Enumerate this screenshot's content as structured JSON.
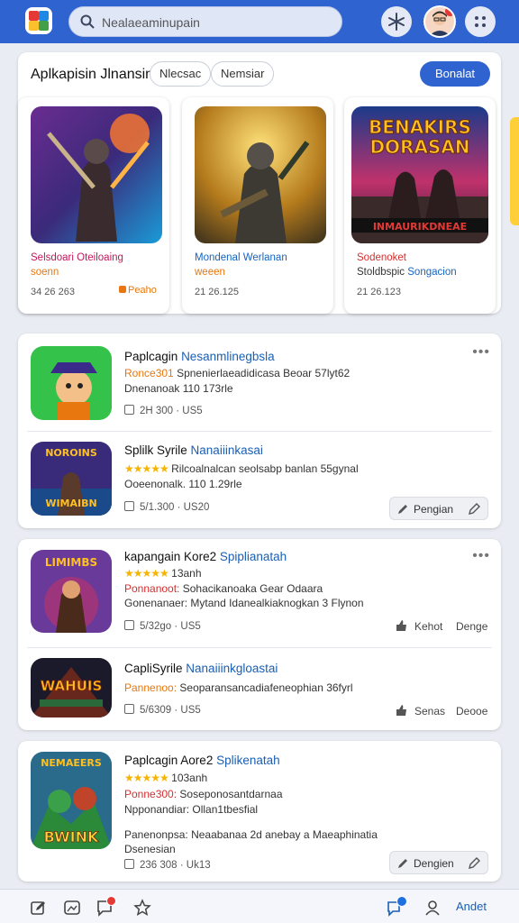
{
  "search": {
    "value": "Nealaeaminupain"
  },
  "featured": {
    "title": "Aplkapisin Jlnansin",
    "chips": [
      "Nlecsac",
      "Nemsiar"
    ],
    "primary_button": "Bonalat",
    "items": [
      {
        "name": "Selsdoari Oteiloaing",
        "sub": "soenn",
        "meta": "34 26 263",
        "tag": "Peaho"
      },
      {
        "name": "Mondenal Werlanan",
        "sub": "weeen",
        "meta": "21 26.125",
        "tag": ""
      },
      {
        "name": "Sodenoket",
        "sub": "Stoldbspic",
        "sub_accent": "Songacion",
        "meta": "21 26.123",
        "tag": ""
      }
    ],
    "art_text": [
      "BENAKIRS",
      "DORASAN",
      "INMAURIKDNEAE"
    ]
  },
  "list": [
    {
      "rows": [
        {
          "title": "Paplcagin",
          "title_accent": "Nesanmlinegbsla",
          "label": "Ronce301",
          "label_color": "orange",
          "line1": "Spnenierlaeadidicasa Beoar 57lyt62",
          "line2": "Dnenanoak 110 173rle",
          "meta": "2H 300 · US5",
          "more": "•••",
          "action": ""
        },
        {
          "title": "Splilk Syrile",
          "title_accent": "Nanaiiinkasai",
          "stars": "★★★★★",
          "line1": "Rilcoalnalcan seolsabp banlan 55gynal",
          "line2": "Ooeenonalk. 110 1.29rle",
          "meta": "5/1.300 · US20",
          "more": "",
          "action": "Pengian"
        }
      ]
    },
    {
      "rows": [
        {
          "title": "kapangain Kore2",
          "title_accent": "Spiplianatah",
          "stars": "★★★★★",
          "stars_text": "13anh",
          "label": "Ponnanoot:",
          "label_color": "red",
          "line1": "Sohacikanoaka Gear Odaara",
          "line2": "Gonenanaer: Mytand Idanealkiaknogkan 3 Flynon",
          "meta": "5/32go · US5",
          "action_left": "Kehot",
          "action_right": "Denge"
        },
        {
          "title": "CapliSyrile",
          "title_accent": "Nanaiiinkgloastai",
          "label": "Pannenoo:",
          "label_color": "orange",
          "line1": "Seoparansancadiafeneophian 36fyrl",
          "meta": "5/6309 · US5",
          "action_left": "Senas",
          "action_right": "Deooe"
        }
      ]
    },
    {
      "rows": [
        {
          "title": "Paplcagin Aore2",
          "title_accent": "Splikenatah",
          "stars": "★★★★★",
          "stars_text": "103anh",
          "label": "Ponne300:",
          "label_color": "red",
          "line1": "Soseponosantdarnaa",
          "line2": "Npponandiar: Ollan1tbesfial",
          "line3": "Panenonpsa: Neaabanaa 2d anebay a Maeaphinatia",
          "line4": "Dsenesian",
          "meta": "236 308 · Uk13",
          "action": "Dengien"
        }
      ]
    }
  ],
  "row_art": [
    "NOROINS",
    "WIMAIBN",
    "LIMIMBS",
    "WAHUIS",
    "NEMAEERS",
    "BWINK"
  ],
  "bottom_bar": {
    "label": "Andet"
  },
  "colors": {
    "brand": "#2f63cf",
    "accent_text": "#1a5fb4",
    "label_orange": "#e8770f",
    "label_red": "#d32f2f",
    "stars": "#f4b400"
  },
  "icons": {
    "top": [
      "app-logo-icon",
      "search-icon",
      "sparkle-icon",
      "avatar",
      "grid-menu-icon"
    ],
    "bottom": [
      "edit-icon",
      "image-icon",
      "chat-icon",
      "star-icon",
      "notification-chat-icon",
      "profile-icon"
    ]
  }
}
